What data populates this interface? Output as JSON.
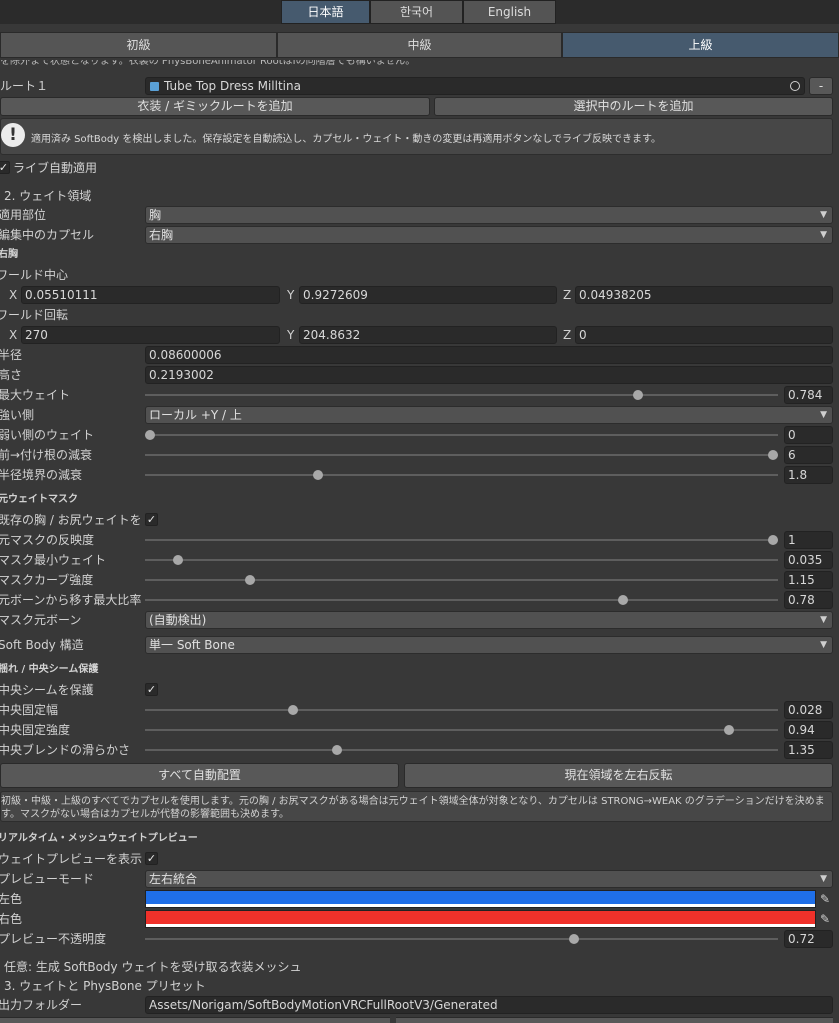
{
  "languages": {
    "ja": "日本語",
    "ko": "한국어",
    "en": "English"
  },
  "modes": {
    "basic": "初級",
    "intermediate": "中級",
    "advanced": "上級"
  },
  "top_cut_text": "を除外まで状態となります。衣装の PhysBoneAnimator RootはIの同階層でも構いません。",
  "root": {
    "label": "ルート１",
    "value": "Tube Top Dress Milltina",
    "remove": "-"
  },
  "buttons": {
    "add_outfit_root": "衣装 / ギミックルートを追加",
    "add_selected_root": "選択中のルートを追加",
    "auto_place_all": "すべて自動配置",
    "mirror_region": "現在領域を左右反転"
  },
  "notice": "適用済み SoftBody を検出しました。保存設定を自動読込し、カプセル・ウェイト・動きの変更は再適用ボタンなしでライブ反映できます。",
  "live_apply": {
    "label": "ライブ自動適用",
    "checked": true
  },
  "weight_section": {
    "title": "2. ウェイト領域",
    "part_label": "適用部位",
    "part_value": "胸",
    "capsule_label": "編集中のカプセル",
    "capsule_value": "右胸",
    "capsule_heading": "右胸",
    "world_center_label": "ワールド中心",
    "center": {
      "x": "0.05510111",
      "y": "0.9272609",
      "z": "0.04938205"
    },
    "world_rotation_label": "ワールド回転",
    "rotation": {
      "x": "270",
      "y": "204.8632",
      "z": "0"
    },
    "axis": {
      "x": "X",
      "y": "Y",
      "z": "Z"
    },
    "radius_label": "半径",
    "radius_value": "0.08600006",
    "height_label": "高さ",
    "height_value": "0.2193002",
    "max_weight": {
      "label": "最大ウェイト",
      "value": "0.784",
      "ratio": 0.784
    },
    "strong_side_label": "強い側",
    "strong_side_value": "ローカル +Y / 上",
    "weak_weight": {
      "label": "弱い側のウェイト",
      "value": "0",
      "ratio": 0.0
    },
    "front_falloff": {
      "label": "前→付け根の減衰",
      "value": "6",
      "ratio": 1.0
    },
    "radius_falloff": {
      "label": "半径境界の減衰",
      "value": "1.8",
      "ratio": 0.27
    }
  },
  "mask_section": {
    "title": "元ウェイトマスク",
    "existing_label": "既存の胸 / お尻ウェイトを使用",
    "existing_checked": true,
    "reflect": {
      "label": "元マスクの反映度",
      "value": "1",
      "ratio": 1.0
    },
    "min_weight": {
      "label": "マスク最小ウェイト",
      "value": "0.035",
      "ratio": 0.045
    },
    "curve": {
      "label": "マスクカーブ強度",
      "value": "1.15",
      "ratio": 0.16
    },
    "max_ratio": {
      "label": "元ボーンから移す最大比率",
      "value": "0.78",
      "ratio": 0.76
    },
    "bone_label": "マスク元ボーン",
    "bone_value": "(自動検出)",
    "softbody_label": "Soft Body 構造",
    "softbody_value": "単一 Soft Bone"
  },
  "seam_section": {
    "title": "揺れ / 中央シーム保護",
    "protect_label": "中央シームを保護",
    "protect_checked": true,
    "fix_width": {
      "label": "中央固定幅",
      "value": "0.028",
      "ratio": 0.23
    },
    "fix_strength": {
      "label": "中央固定強度",
      "value": "0.94",
      "ratio": 0.93
    },
    "blend": {
      "label": "中央ブレンドの滑らかさ",
      "value": "1.35",
      "ratio": 0.3
    }
  },
  "info_text": "初級・中級・上級のすべてでカプセルを使用します。元の胸 / お尻マスクがある場合は元ウェイト領域全体が対象となり、カプセルは STRONG→WEAK のグラデーションだけを決めます。マスクがない場合はカプセルが代替の影響範囲も決めます。",
  "preview_section": {
    "title": "リアルタイム・メッシュウェイトプレビュー",
    "show_label": "ウェイトプレビューを表示",
    "show_checked": true,
    "mode_label": "プレビューモード",
    "mode_value": "左右統合",
    "left_color_label": "左色",
    "left_color": "#1f6fe8",
    "right_color_label": "右色",
    "right_color": "#f0312a",
    "opacity": {
      "label": "プレビュー不透明度",
      "value": "0.72",
      "ratio": 0.68
    }
  },
  "optional_text": "任意: 生成 SoftBody ウェイトを受け取る衣装メッシュ",
  "section3_title": "3. ウェイトと PhysBone プリセット",
  "output_label": "出力フォルダー",
  "output_value": "Assets/Norigam/SoftBodyMotionVRCFullRootV3/Generated"
}
